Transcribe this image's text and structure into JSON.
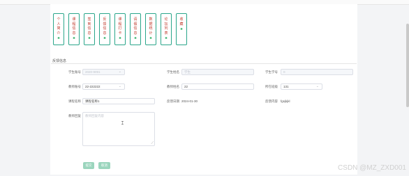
{
  "nav": {
    "items": [
      {
        "label": "个人简介",
        "chars": [
          "个",
          "人",
          "简",
          "介"
        ]
      },
      {
        "label": "课程信息",
        "chars": [
          "课",
          "程",
          "信",
          "息"
        ]
      },
      {
        "label": "签到信息",
        "chars": [
          "签",
          "到",
          "信",
          "息"
        ]
      },
      {
        "label": "反馈信息",
        "chars": [
          "反",
          "馈",
          "信",
          "息"
        ]
      },
      {
        "label": "课程打卡",
        "chars": [
          "课",
          "程",
          "打",
          "卡"
        ]
      },
      {
        "label": "请假信息",
        "chars": [
          "请",
          "假",
          "信",
          "息"
        ]
      },
      {
        "label": "数据统计",
        "chars": [
          "数",
          "据",
          "统",
          "计"
        ]
      },
      {
        "label": "论坛列表",
        "chars": [
          "论",
          "坛",
          "列",
          "表"
        ]
      },
      {
        "label": "收藏",
        "chars": [
          "收",
          "藏"
        ]
      }
    ]
  },
  "form": {
    "section_title": "反馈信息",
    "student_id_label": "学生账号",
    "student_id_value": "2020-9091",
    "student_name_label": "学生姓名",
    "student_name_value": "学生",
    "student_no_label": "学生学号",
    "student_no_value": "0",
    "teacher_id_label": "教师账号",
    "teacher_id_value": "22-222222",
    "teacher_name_label": "教师姓名",
    "teacher_name_value": "22",
    "class_label": "所在班级",
    "class_value": "131",
    "course_label": "课程名称",
    "course_value": "课程名称1",
    "date_label": "反馈日期",
    "date_value": "2024-01-30",
    "content_label": "反馈内容",
    "content_value": "fgsjkjkl",
    "reply_label": "教师回复",
    "reply_placeholder": "教师回复内容",
    "submit_label": "提交",
    "cancel_label": "取消"
  },
  "watermark": "CSDN @MZ_ZXD001"
}
